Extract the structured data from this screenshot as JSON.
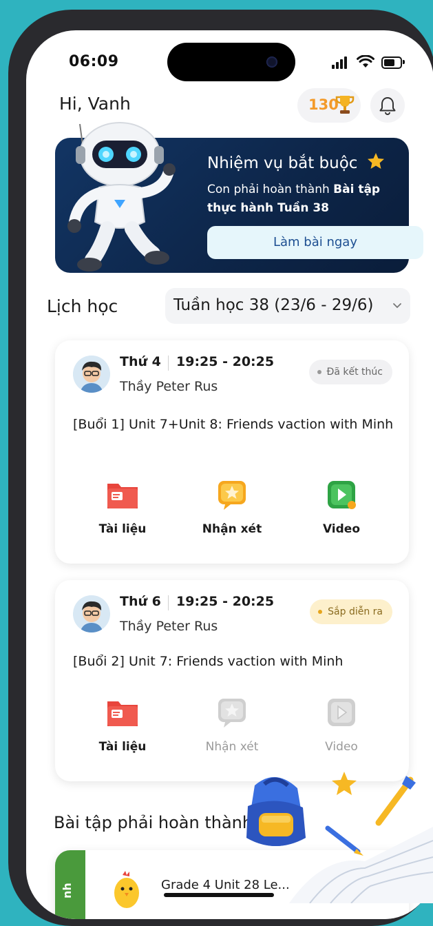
{
  "status_bar": {
    "time": "06:09"
  },
  "header": {
    "greeting": "Hi, Vanh",
    "points": "130"
  },
  "mission": {
    "title": "Nhiệm vụ bắt buộc",
    "desc_prefix": "Con phải hoàn thành ",
    "desc_bold": "Bài tập thực hành Tuần 38",
    "cta": "Làm bài ngay"
  },
  "schedule": {
    "label": "Lịch học",
    "week": "Tuần học 38 (23/6 - 29/6)",
    "sessions": [
      {
        "day": "Thứ 4",
        "time": "19:25 - 20:25",
        "teacher": "Thầy Peter Rus",
        "status": "Đã kết thúc",
        "lesson_prefix": "[Buổi 1]",
        "lesson_title": "Unit 7+Unit 8: Friends vaction with Minh",
        "actions": [
          {
            "label": "Tài liệu",
            "enabled": true
          },
          {
            "label": "Nhận xét",
            "enabled": true
          },
          {
            "label": "Video",
            "enabled": true
          }
        ]
      },
      {
        "day": "Thứ 6",
        "time": "19:25 - 20:25",
        "teacher": "Thầy Peter Rus",
        "status": "Sắp diễn ra",
        "lesson_prefix": "[Buổi 2]",
        "lesson_title": "Unit 7: Friends vaction with Minh",
        "actions": [
          {
            "label": "Tài liệu",
            "enabled": true
          },
          {
            "label": "Nhận xét",
            "enabled": false
          },
          {
            "label": "Video",
            "enabled": false
          }
        ]
      }
    ]
  },
  "homework": {
    "title": "Bài tập phải hoàn thành",
    "tab": "nh",
    "item": "Grade 4 Unit 28 Le..."
  },
  "colors": {
    "background": "#2fb3bf",
    "mission_card": "#0d2548",
    "points": "#f39a2a",
    "cta_text": "#1c4e91",
    "homework_tab": "#4a9a3c"
  },
  "icons": [
    "signal-icon",
    "wifi-icon",
    "battery-icon",
    "trophy-icon",
    "bell-icon",
    "star-icon",
    "robot-mascot",
    "document-folder-icon",
    "feedback-star-icon",
    "video-play-icon",
    "chevron-down-icon",
    "backpack-decoration",
    "paintbrush-decoration",
    "book-decoration",
    "chick-icon"
  ]
}
